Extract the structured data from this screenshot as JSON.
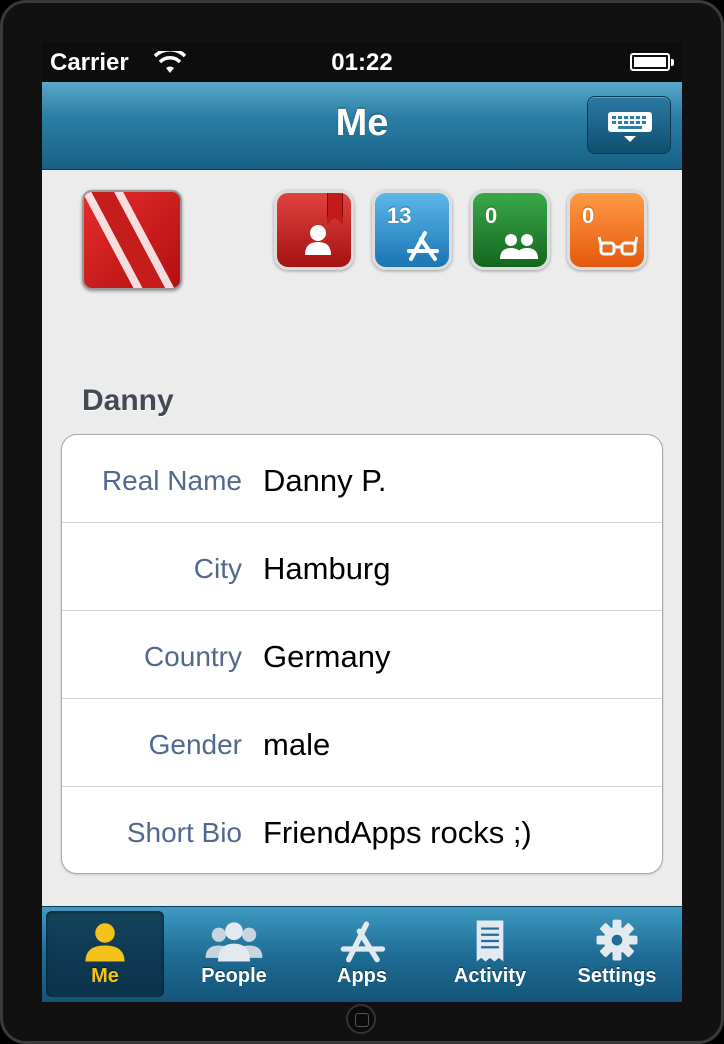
{
  "status_bar": {
    "carrier": "Carrier",
    "time": "01:22"
  },
  "nav": {
    "title": "Me"
  },
  "profile": {
    "username": "Danny",
    "badges": [
      {
        "name": "bookmarks",
        "count": "",
        "color": "#c0201d"
      },
      {
        "name": "apps",
        "count": "13",
        "color": "#2a86c6"
      },
      {
        "name": "friends",
        "count": "0",
        "color": "#1f7d2b"
      },
      {
        "name": "followers",
        "count": "0",
        "color": "#f27021"
      }
    ]
  },
  "fields": [
    {
      "label": "Real Name",
      "value": "Danny P."
    },
    {
      "label": "City",
      "value": "Hamburg"
    },
    {
      "label": "Country",
      "value": "Germany"
    },
    {
      "label": "Gender",
      "value": "male"
    },
    {
      "label": "Short Bio",
      "value": "FriendApps rocks ;)"
    }
  ],
  "actions": {
    "update_label": ""
  },
  "tabs": [
    {
      "label": "Me",
      "icon": "person-icon",
      "selected": true
    },
    {
      "label": "People",
      "icon": "people-icon",
      "selected": false
    },
    {
      "label": "Apps",
      "icon": "appstore-icon",
      "selected": false
    },
    {
      "label": "Activity",
      "icon": "receipt-icon",
      "selected": false
    },
    {
      "label": "Settings",
      "icon": "gear-icon",
      "selected": false
    }
  ],
  "colors": {
    "accent_selected_tab": "#f5c21b",
    "label_blue": "#52688f"
  }
}
